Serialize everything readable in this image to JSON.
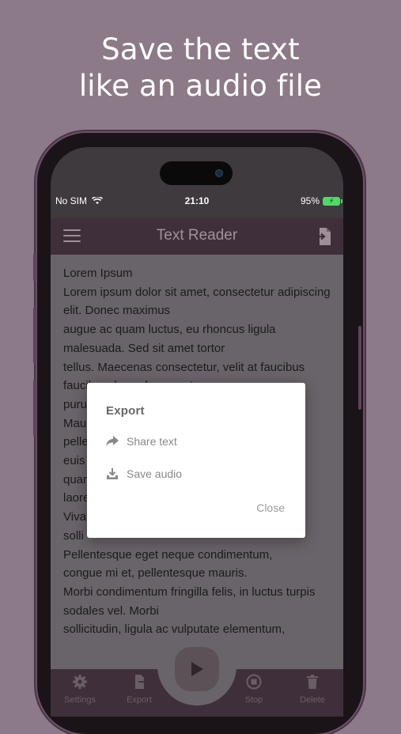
{
  "headline": {
    "line1": "Save the text",
    "line2": "like an audio file"
  },
  "status_bar": {
    "carrier": "No SIM",
    "time": "21:10",
    "battery": "95%"
  },
  "appbar": {
    "title": "Text Reader"
  },
  "reader": {
    "text": "Lorem Ipsum\nLorem ipsum dolor sit amet, consectetur adipiscing elit. Donec maximus\naugue ac quam luctus, eu rhoncus ligula malesuada. Sed sit amet tortor\ntellus. Maecenas consectetur, velit at faucibus faucibus, lacus leo egestas\npurus\nMau\npelle                                                   oin\neuis\nquam                                                  o\nlaore\nViva\nsolli\nPellentesque eget neque condimentum,\ncongue mi et, pellentesque mauris.\nMorbi condimentum fringilla felis, in luctus turpis sodales vel. Morbi\nsollicitudin, ligula ac vulputate elementum,"
  },
  "dialog": {
    "title": "Export",
    "share_label": "Share text",
    "save_label": "Save audio",
    "close_label": "Close"
  },
  "bottom_nav": {
    "settings": "Settings",
    "export": "Export",
    "stop": "Stop",
    "delete": "Delete"
  },
  "icons": {
    "share": "share-arrow-icon",
    "save": "download-icon",
    "menu": "hamburger-icon",
    "export": "export-file-icon",
    "play": "play-icon",
    "settings": "gear-icon",
    "stop": "stop-icon",
    "delete": "trash-icon"
  },
  "colors": {
    "background": "#8c7a88",
    "appbar": "#3f2f3a",
    "battery": "#4cd964"
  }
}
